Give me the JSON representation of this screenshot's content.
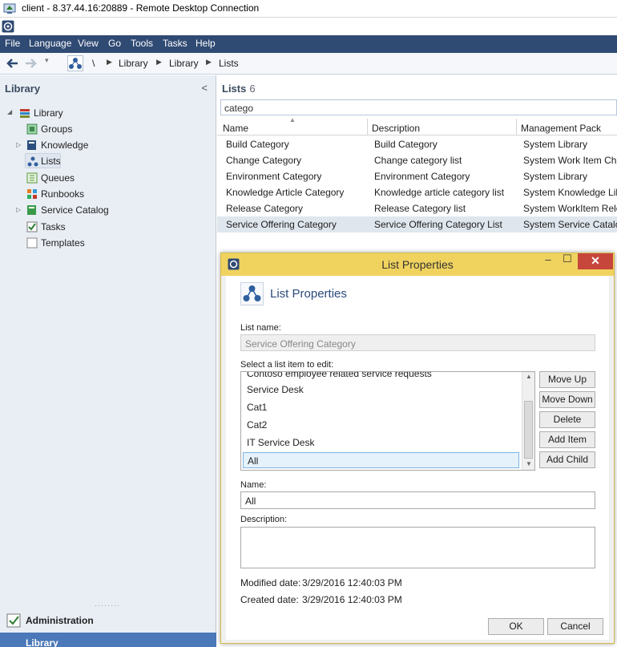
{
  "rdp": {
    "title": "client - 8.37.44.16:20889 - Remote Desktop Connection"
  },
  "menu": [
    "File",
    "Language",
    "View",
    "Go",
    "Tools",
    "Tasks",
    "Help"
  ],
  "breadcrumb": {
    "root": "\\",
    "items": [
      "Library",
      "Library",
      "Lists"
    ]
  },
  "left": {
    "title": "Library",
    "collapse": "<",
    "tree": {
      "root": "Library",
      "items": [
        "Groups",
        "Knowledge",
        "Lists",
        "Queues",
        "Runbooks",
        "Service Catalog",
        "Tasks",
        "Templates"
      ]
    },
    "workspaces": [
      "Administration",
      "Library"
    ]
  },
  "right": {
    "title": "Lists",
    "count": "6",
    "filter": "catego",
    "columns": [
      "Name",
      "Description",
      "Management Pack"
    ],
    "rows": [
      [
        "Build Category",
        "Build Category",
        "System Library"
      ],
      [
        "Change Category",
        "Change category list",
        "System Work Item Cha"
      ],
      [
        "Environment Category",
        "Environment Category",
        "System Library"
      ],
      [
        "Knowledge Article Category",
        "Knowledge article category list",
        "System Knowledge Libr"
      ],
      [
        "Release Category",
        "Release Category list",
        "System WorkItem Rele"
      ],
      [
        "Service Offering Category",
        "Service Offering Category List",
        "System Service Catalog"
      ]
    ]
  },
  "dialog": {
    "window_title": "List Properties",
    "heading": "List Properties",
    "list_name_label": "List name:",
    "list_name_value": "Service Offering Category",
    "select_label": "Select a list item to edit:",
    "partial_item": "Contoso employee related service requests",
    "items": [
      "Service Desk",
      "Cat1",
      "Cat2",
      "IT Service Desk",
      "All"
    ],
    "buttons": [
      "Move Up",
      "Move Down",
      "Delete",
      "Add Item",
      "Add Child"
    ],
    "name_label": "Name:",
    "name_value": "All",
    "description_label": "Description:",
    "description_value": "",
    "modified_label": "Modified date:",
    "modified_value": "3/29/2016 12:40:03 PM",
    "created_label": "Created date:",
    "created_value": "3/29/2016 12:40:03 PM",
    "ok": "OK",
    "cancel": "Cancel",
    "minimize": "–",
    "maximize": "☐",
    "close": "✕"
  },
  "colors": {
    "menubar": "#2f4a73",
    "dialog_title": "#f0d35f",
    "close": "#c7463c",
    "heading": "#2b4a7a"
  }
}
